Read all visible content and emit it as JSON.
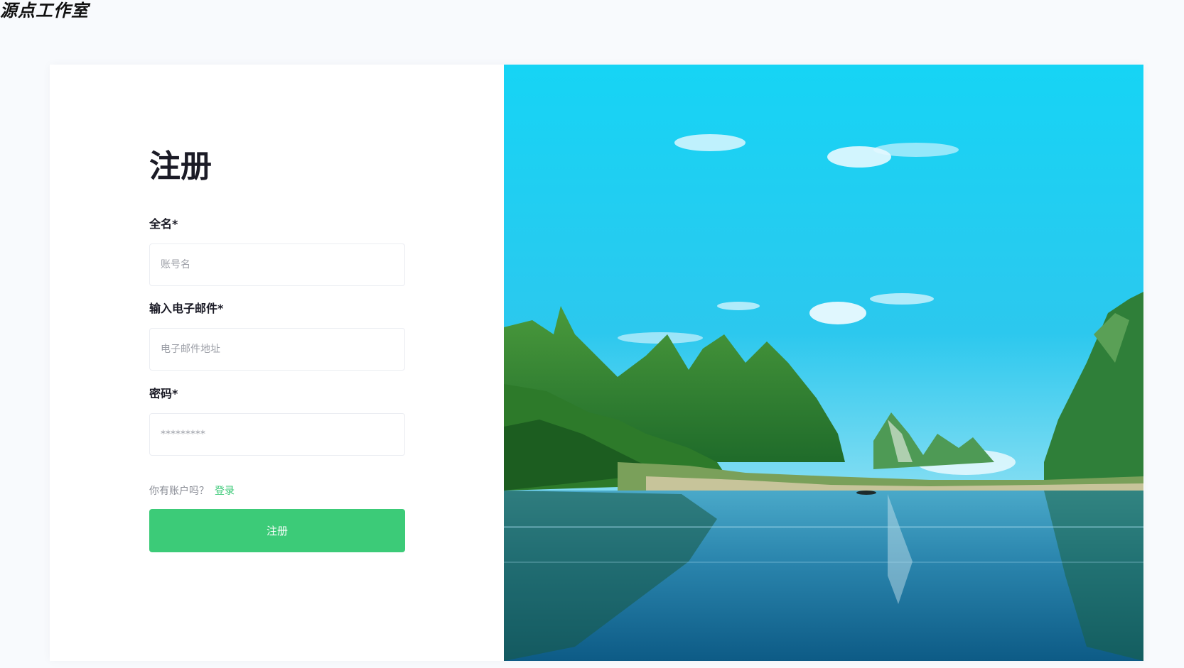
{
  "brand": {
    "name": "源点工作室"
  },
  "form": {
    "title": "注册",
    "name_label": "全名*",
    "name_placeholder": "账号名",
    "email_label": "输入电子邮件*",
    "email_placeholder": "电子邮件地址",
    "password_label": "密码*",
    "password_placeholder": "*********",
    "account_prompt": "你有账户吗？",
    "login_link": "登录",
    "submit_label": "注册"
  },
  "colors": {
    "accent": "#3ccb78",
    "link": "#3ac876",
    "page_background": "#f8fafd"
  },
  "image": {
    "subject": "karst-mountains-river-landscape"
  }
}
